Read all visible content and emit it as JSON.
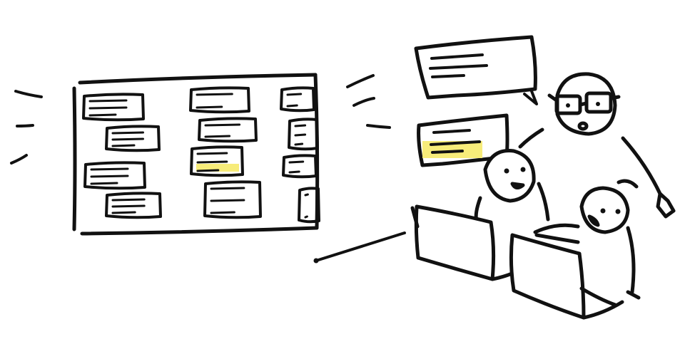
{
  "colors": {
    "ink": "#111111",
    "paper": "#ffffff",
    "highlight": "#f7ec7a"
  },
  "illustration": {
    "board": {
      "columns": 3,
      "cards": [
        {
          "column": 1,
          "lines": 3,
          "highlighted": false
        },
        {
          "column": 1,
          "lines": 3,
          "highlighted": false
        },
        {
          "column": 1,
          "lines": 3,
          "highlighted": false
        },
        {
          "column": 1,
          "lines": 3,
          "highlighted": false
        },
        {
          "column": 2,
          "lines": 2,
          "highlighted": false
        },
        {
          "column": 2,
          "lines": 2,
          "highlighted": false
        },
        {
          "column": 2,
          "lines": 3,
          "highlighted": true
        },
        {
          "column": 2,
          "lines": 3,
          "highlighted": false
        },
        {
          "column": 3,
          "lines": 2,
          "highlighted": false
        },
        {
          "column": 3,
          "lines": 3,
          "highlighted": false
        },
        {
          "column": 3,
          "lines": 2,
          "highlighted": false
        },
        {
          "column": 3,
          "lines": 2,
          "highlighted": false
        }
      ]
    },
    "speech_bubbles": [
      {
        "lines": 3,
        "highlighted": false
      },
      {
        "lines": 3,
        "highlighted": true
      }
    ],
    "people": [
      {
        "role": "standing-with-glasses",
        "laptop": false
      },
      {
        "role": "seated-left",
        "laptop": true
      },
      {
        "role": "seated-right",
        "laptop": true
      }
    ]
  }
}
